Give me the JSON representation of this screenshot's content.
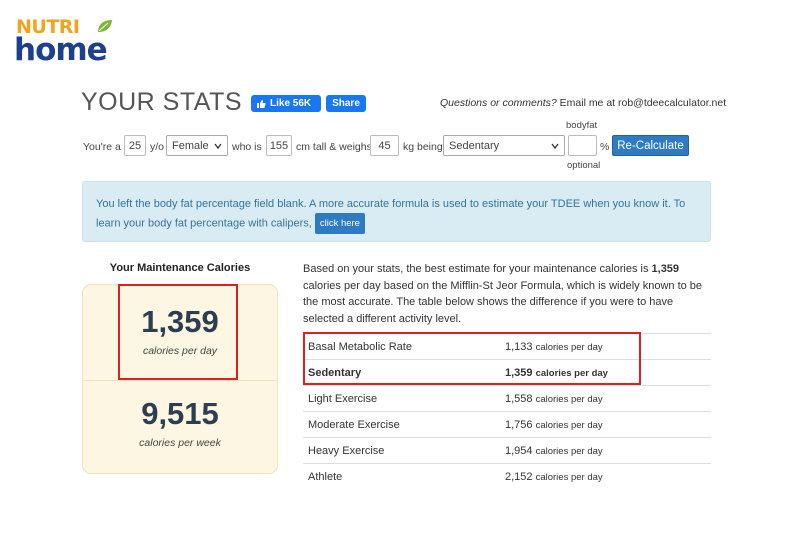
{
  "logo": {
    "top": "NUTRI",
    "bottom": "home"
  },
  "header": {
    "title": "YOUR STATS",
    "fb_like": "Like 56K",
    "fb_share": "Share",
    "contact_question": "Questions or comments?",
    "contact_rest": "Email me at rob@tdeecalculator.net"
  },
  "form": {
    "youre_a": "You're a",
    "age": "25",
    "yo": "y/o",
    "gender": "Female",
    "who_is": "who is",
    "height": "155",
    "cm_tall": "cm tall & weighs",
    "weight": "45",
    "kg_being": "kg being",
    "activity": "Sedentary",
    "bodyfat_label": "bodyfat",
    "bodyfat_value": "",
    "percent": "%",
    "optional": "optional",
    "recalc": "Re-Calculate"
  },
  "alert": {
    "text": "You left the body fat percentage field blank. A more accurate formula is used to estimate your TDEE when you know it. To learn your body fat percentage with calipers,",
    "button": "click here"
  },
  "maintenance": {
    "title": "Your Maintenance Calories",
    "per_day": "1,359",
    "per_day_label": "calories per day",
    "per_week": "9,515",
    "per_week_label": "calories per week"
  },
  "description": {
    "intro": "Based on your stats, the best estimate for your maintenance calories is",
    "value": "1,359",
    "rest": "calories per day based on the Mifflin-St Jeor Formula, which is widely known to be the most accurate. The table below shows the difference if you were to have selected a different activity level."
  },
  "levels": [
    {
      "name": "Basal Metabolic Rate",
      "value": "1,133",
      "unit": "calories per day"
    },
    {
      "name": "Sedentary",
      "value": "1,359",
      "unit": "calories per day"
    },
    {
      "name": "Light Exercise",
      "value": "1,558",
      "unit": "calories per day"
    },
    {
      "name": "Moderate Exercise",
      "value": "1,756",
      "unit": "calories per day"
    },
    {
      "name": "Heavy Exercise",
      "value": "1,954",
      "unit": "calories per day"
    },
    {
      "name": "Athlete",
      "value": "2,152",
      "unit": "calories per day"
    }
  ],
  "colors": {
    "brand_orange": "#f7a21b",
    "brand_blue": "#1d3f8f",
    "button_blue": "#2e7bc4",
    "highlight_red": "#e02020",
    "card_bg": "#fcf6e3"
  }
}
